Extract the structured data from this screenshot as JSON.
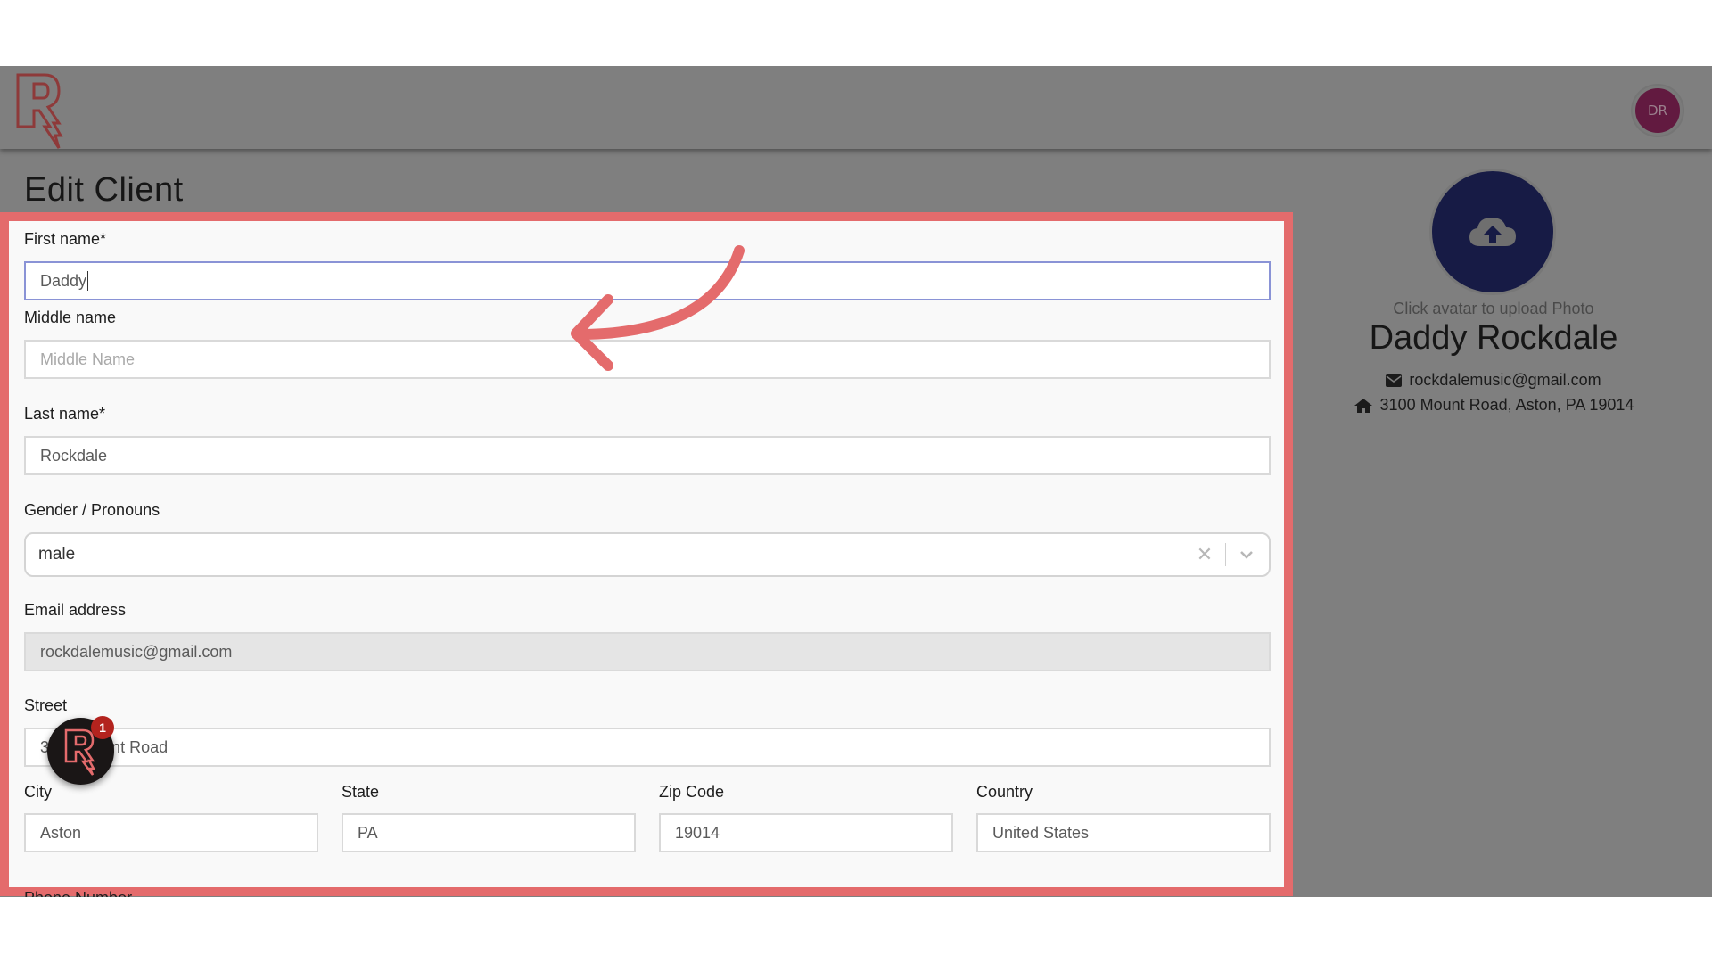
{
  "header": {
    "logo_alt": "Rockdale logo",
    "user_initials": "DR",
    "user_avatar_color": "#621a40"
  },
  "page": {
    "title": "Edit Client"
  },
  "form": {
    "first_name": {
      "label": "First name*",
      "value": "Daddy"
    },
    "middle_name": {
      "label": "Middle name",
      "placeholder": "Middle Name",
      "value": ""
    },
    "last_name": {
      "label": "Last name*",
      "value": "Rockdale"
    },
    "gender": {
      "label": "Gender / Pronouns",
      "value": "male"
    },
    "email": {
      "label": "Email address",
      "value": "rockdalemusic@gmail.com"
    },
    "street": {
      "label": "Street",
      "value": "3100 Mount Road"
    },
    "city": {
      "label": "City",
      "value": "Aston"
    },
    "state": {
      "label": "State",
      "value": "PA"
    },
    "zip": {
      "label": "Zip Code",
      "value": "19014"
    },
    "country": {
      "label": "Country",
      "value": "United States"
    },
    "next_label_partial": "Phone Number"
  },
  "profile": {
    "upload_caption": "Click avatar to upload Photo",
    "name": "Daddy Rockdale",
    "email": "rockdalemusic@gmail.com",
    "address": "3100 Mount Road, Aston, PA 19014"
  },
  "widget": {
    "badge_count": "1"
  },
  "colors": {
    "highlight": "#e46b6c",
    "avatar_upload_bg": "#171b45",
    "overlay_gray": "#7f7f7f"
  }
}
